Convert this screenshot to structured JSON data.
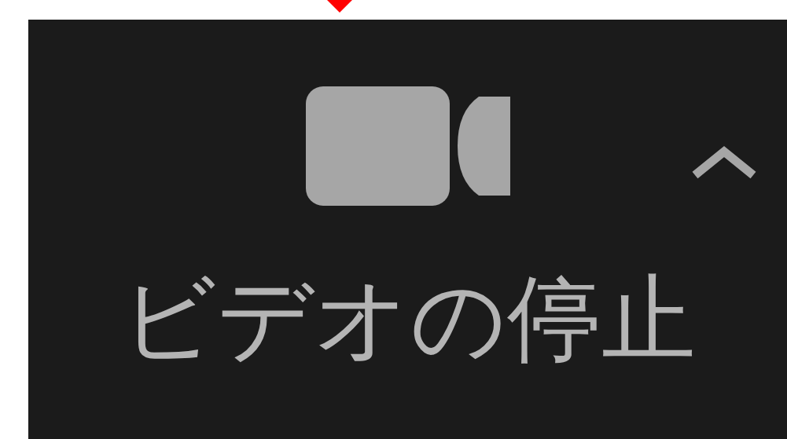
{
  "button": {
    "label": "ビデオの停止"
  }
}
